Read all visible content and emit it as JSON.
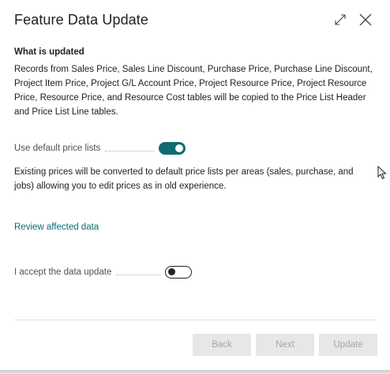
{
  "dialog": {
    "title": "Feature Data Update",
    "expand_icon": "expand-icon",
    "close_icon": "close-icon"
  },
  "section": {
    "heading": "What is updated",
    "description": "Records from Sales Price, Sales Line Discount, Purchase Price, Purchase Line Discount, Project Item Price, Project G/L Account Price, Project Resource Price, Project Resource Price, Resource Price, and Resource Cost tables will be copied to the Price List Header and Price List Line tables."
  },
  "default_price_lists": {
    "label": "Use default price lists",
    "enabled": true
  },
  "info_text": "Existing prices will be converted to default price lists per areas (sales, purchase, and jobs) allowing you to edit prices as in old experience.",
  "review_link": "Review affected data",
  "accept": {
    "label": "I accept the data update",
    "enabled": false
  },
  "buttons": {
    "back": "Back",
    "next": "Next",
    "update": "Update"
  },
  "colors": {
    "accent": "#0f6a72",
    "link": "#0b6a73",
    "disabled_button_bg": "#e7e7e7",
    "disabled_button_text": "#a6a6a6"
  }
}
